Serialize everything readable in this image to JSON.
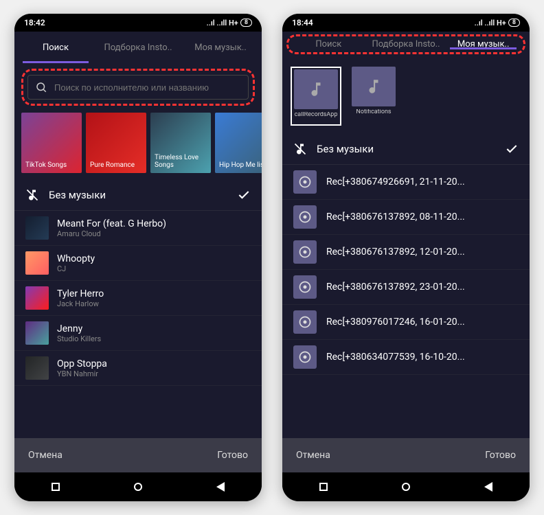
{
  "left": {
    "statusbar": {
      "time": "18:42",
      "signal": "..ıl ..ıll H+",
      "battery": "8"
    },
    "tabs": [
      {
        "label": "Поиск",
        "active": true
      },
      {
        "label": "Подборка Insto..",
        "active": false
      },
      {
        "label": "Моя музык..",
        "active": false
      }
    ],
    "search_placeholder": "Поиск по исполнителю или названию",
    "playlists": [
      "TikTok Songs",
      "Pure Romance",
      "Timeless Love Songs",
      "Hip Hop Me list"
    ],
    "no_music_label": "Без музыки",
    "tracks": [
      {
        "title": "Meant For (feat. G Herbo)",
        "artist": "Amaru Cloud"
      },
      {
        "title": "Whoopty",
        "artist": "CJ"
      },
      {
        "title": "Tyler Herro",
        "artist": "Jack Harlow"
      },
      {
        "title": "Jenny",
        "artist": "Studio Killers"
      },
      {
        "title": "Opp Stoppa",
        "artist": "YBN Nahmir"
      }
    ],
    "footer": {
      "cancel": "Отмена",
      "done": "Готово"
    }
  },
  "right": {
    "statusbar": {
      "time": "18:44",
      "signal": "..ıl ..ıll H+",
      "battery": "8"
    },
    "tabs": [
      {
        "label": "Поиск",
        "active": false
      },
      {
        "label": "Подборка Insto..",
        "active": false
      },
      {
        "label": "Моя музык..",
        "active": true
      }
    ],
    "folders": [
      {
        "label": "callRecordsApp",
        "selected": true
      },
      {
        "label": "Notifications",
        "selected": false
      }
    ],
    "no_music_label": "Без музыки",
    "recordings": [
      "Rec[+380674926691, 21-11-20...",
      "Rec[+380676137892, 08-11-20...",
      "Rec[+380676137892, 12-01-20...",
      "Rec[+380676137892, 23-01-20...",
      "Rec[+380976017246, 16-01-20...",
      "Rec[+380634077539, 16-10-20..."
    ],
    "footer": {
      "cancel": "Отмена",
      "done": "Готово"
    }
  }
}
